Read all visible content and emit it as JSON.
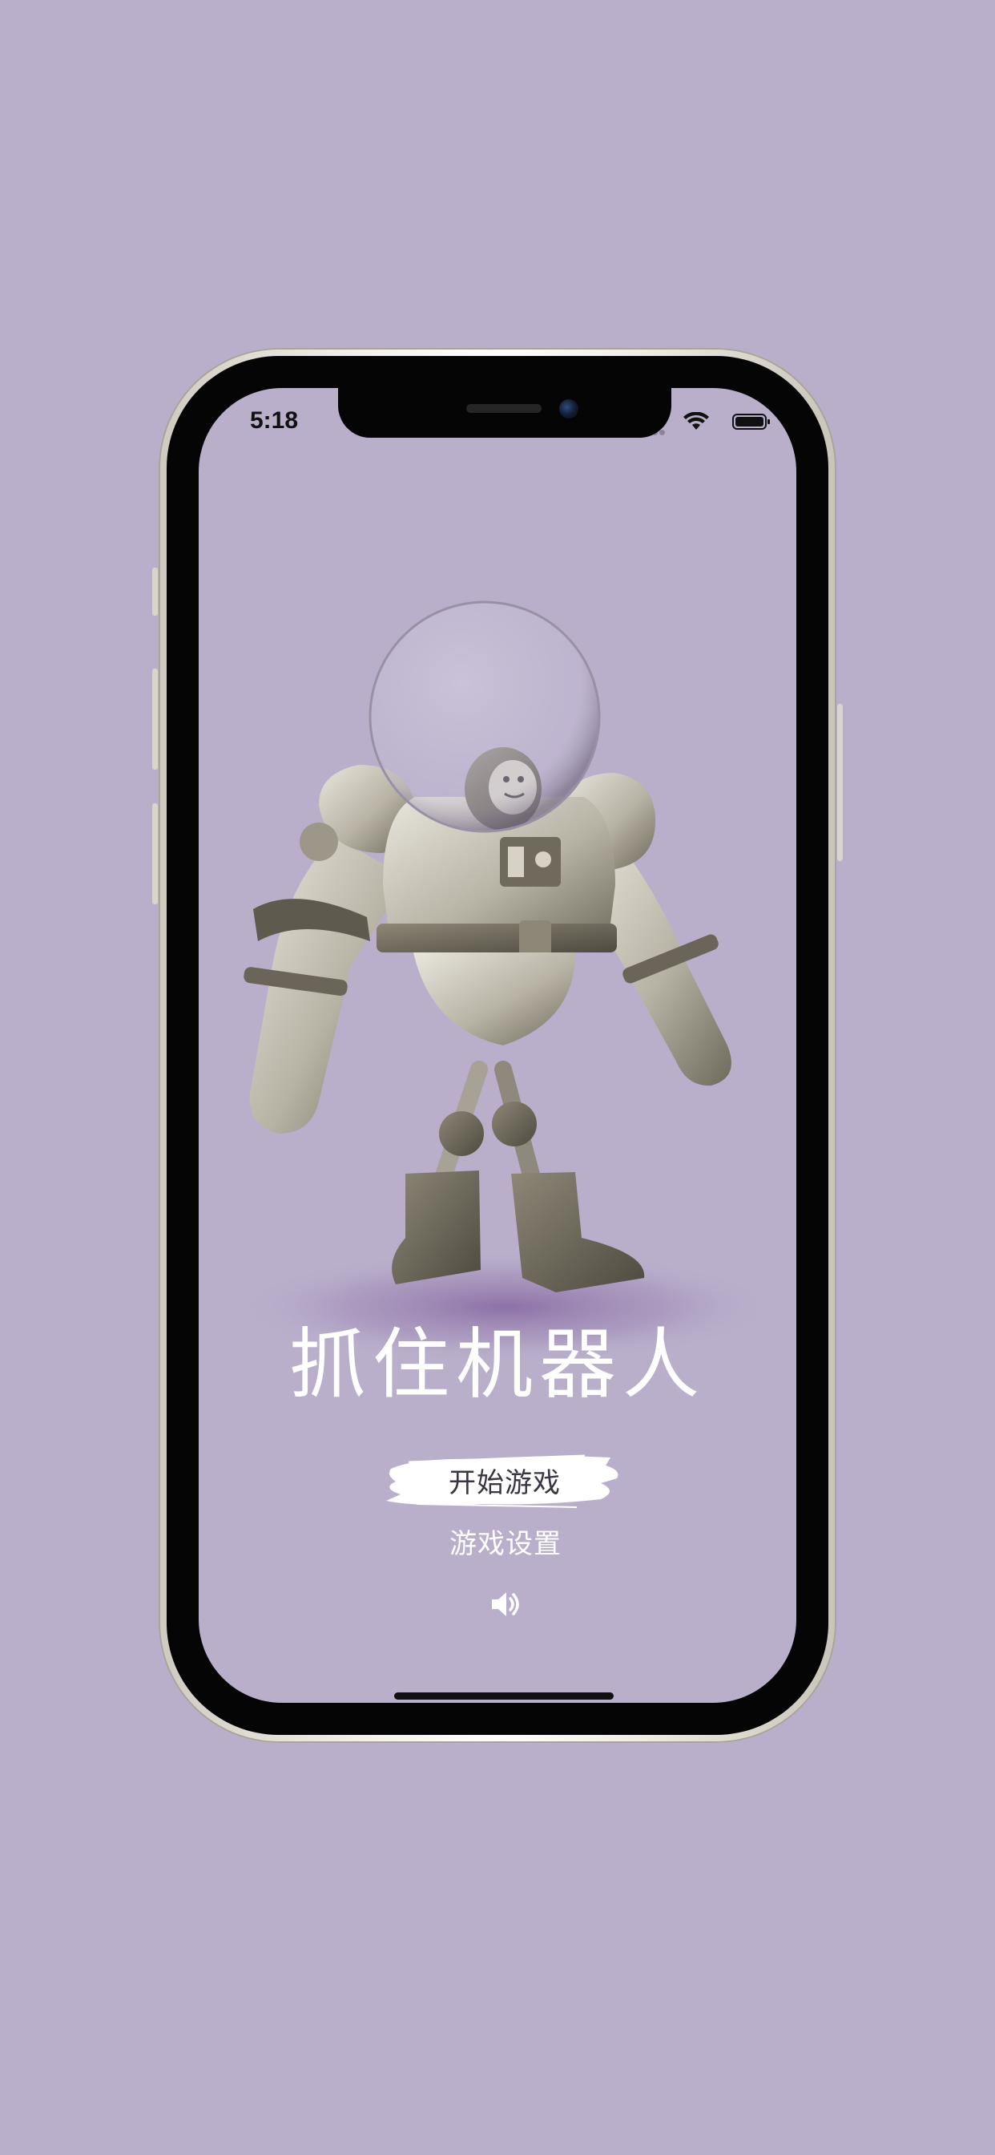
{
  "status_bar": {
    "time": "5:18",
    "icons": [
      "cellular-icon",
      "wifi-icon",
      "battery-icon"
    ]
  },
  "game": {
    "title": "抓住机器人",
    "start_label": "开始游戏",
    "settings_label": "游戏设置",
    "sound_icon": "speaker-icon"
  },
  "colors": {
    "background": "#b9afcb",
    "title": "#ffffff",
    "start_text": "#3a3540",
    "brush": "#ffffff"
  }
}
